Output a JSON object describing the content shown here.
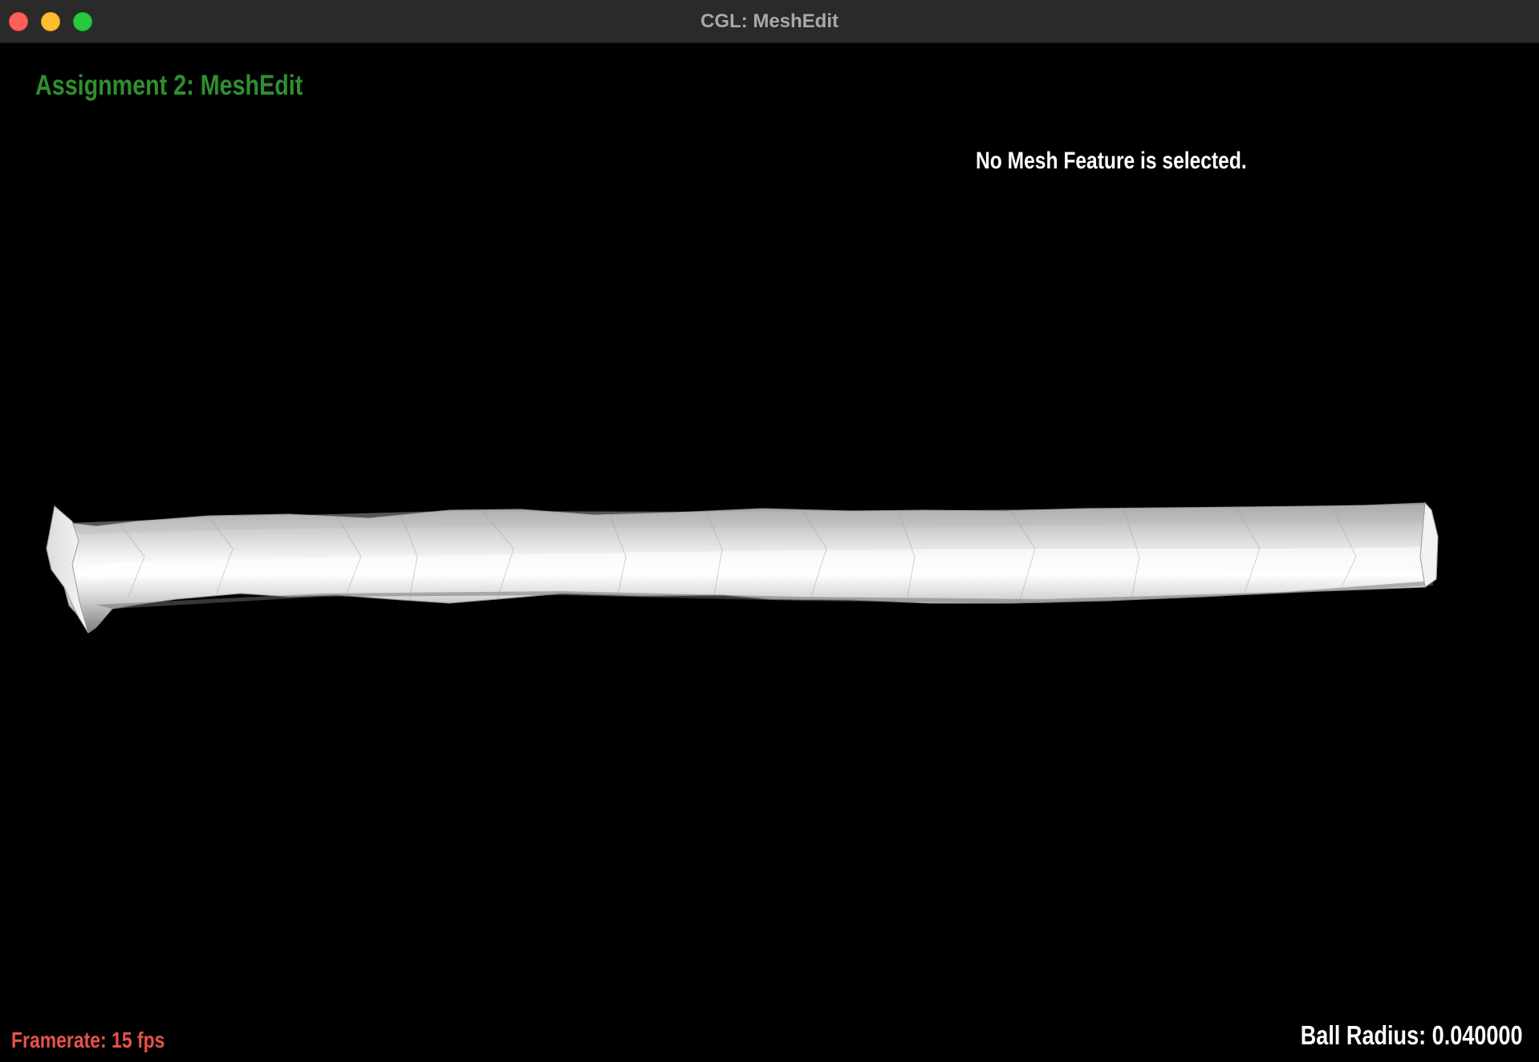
{
  "window": {
    "title": "CGL: MeshEdit"
  },
  "overlay": {
    "assignment_title": "Assignment 2: MeshEdit",
    "selection_status": "No Mesh Feature is selected.",
    "framerate": "Framerate: 15 fps",
    "ball_radius": "Ball Radius: 0.040000"
  },
  "colors": {
    "assignment_title": "#2f8f2f",
    "selection_status": "#ffffff",
    "framerate": "#e8524c",
    "ball_radius": "#ffffff",
    "background": "#000000"
  }
}
